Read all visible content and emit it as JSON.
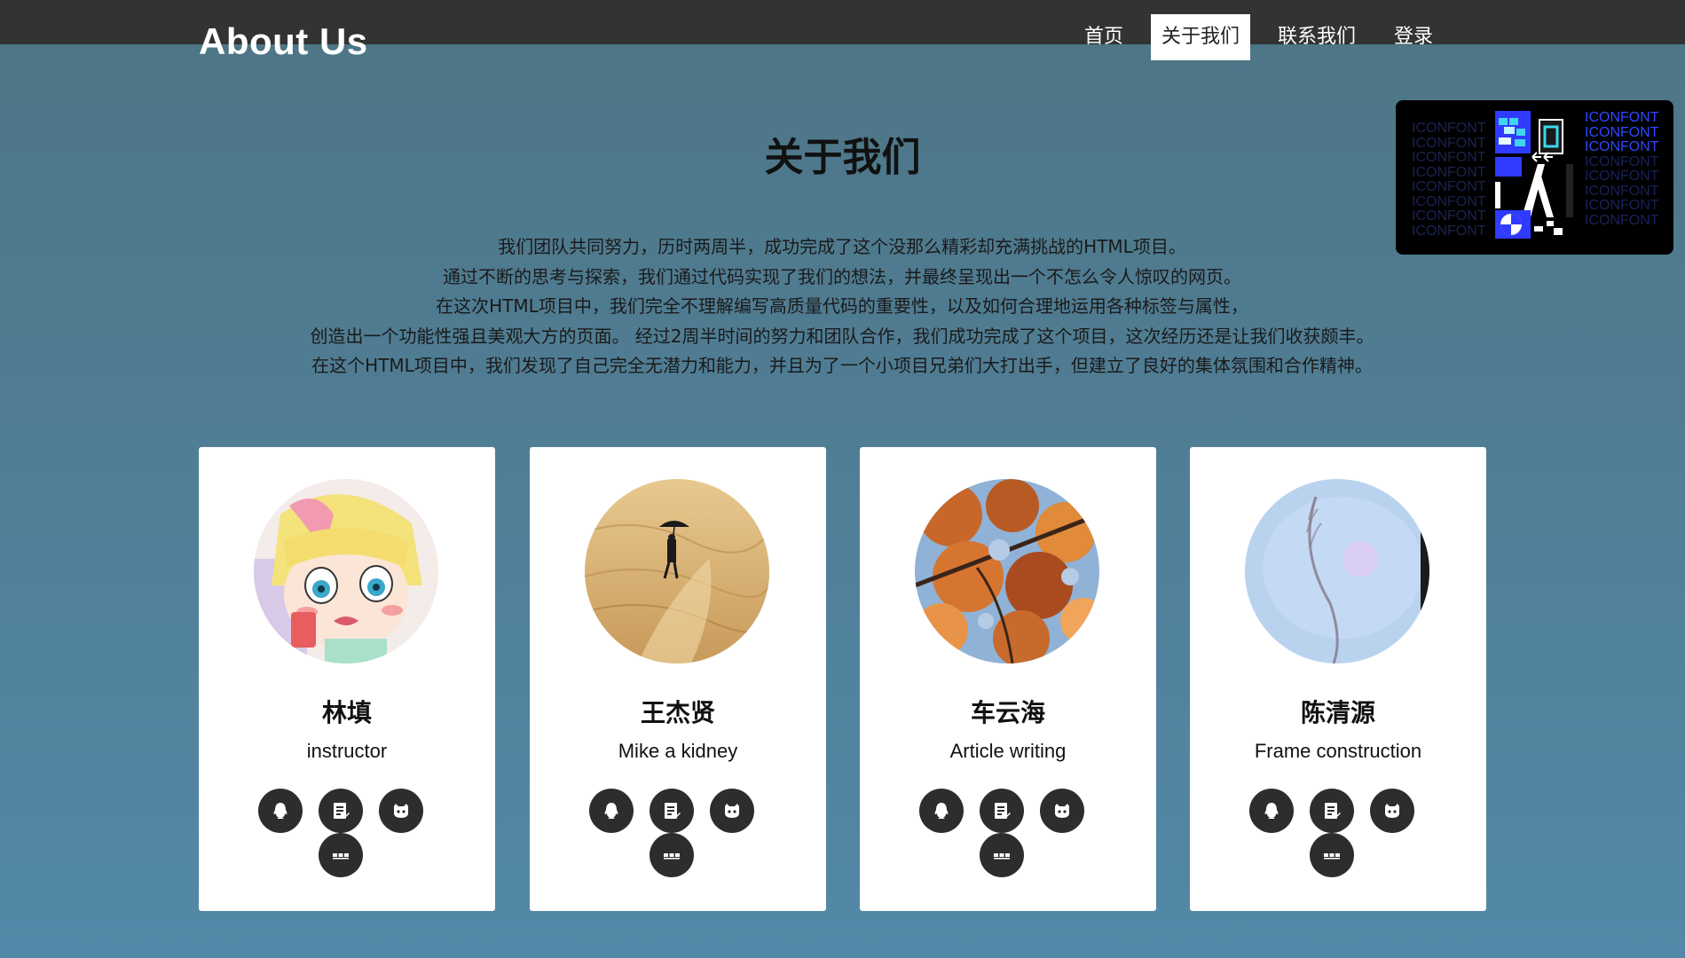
{
  "brand": "About Us",
  "nav": {
    "items": [
      {
        "label": "首页",
        "active": false
      },
      {
        "label": "关于我们",
        "active": true
      },
      {
        "label": "联系我们",
        "active": false
      },
      {
        "label": "登录",
        "active": false
      }
    ]
  },
  "promo": {
    "text": "ICONFONT"
  },
  "page": {
    "title": "关于我们",
    "intro": [
      "我们团队共同努力，历时两周半，成功完成了这个没那么精彩却充满挑战的HTML项目。",
      "通过不断的思考与探索，我们通过代码实现了我们的想法，并最终呈现出一个不怎么令人惊叹的网页。",
      "在这次HTML项目中，我们完全不理解编写高质量代码的重要性，以及如何合理地运用各种标签与属性，",
      "创造出一个功能性强且美观大方的页面。 经过2周半时间的努力和团队合作，我们成功完成了这个项目，这次经历还是让我们收获颇丰。",
      "在这个HTML项目中，我们发现了自己完全无潜力和能力，并且为了一个小项目兄弟们大打出手，但建立了良好的集体氛围和合作精神。"
    ]
  },
  "members": [
    {
      "name": "林填",
      "role": "instructor"
    },
    {
      "name": "王杰贤",
      "role": "Mike a kidney"
    },
    {
      "name": "车云海",
      "role": "Article writing"
    },
    {
      "name": "陈清源",
      "role": "Frame construction"
    }
  ],
  "social_icons": [
    "qq-icon",
    "blog-icon",
    "github-icon",
    "more-icon"
  ],
  "colors": {
    "topbar": "#333333",
    "card": "#ffffff",
    "icon_button": "#2d2d2d"
  }
}
